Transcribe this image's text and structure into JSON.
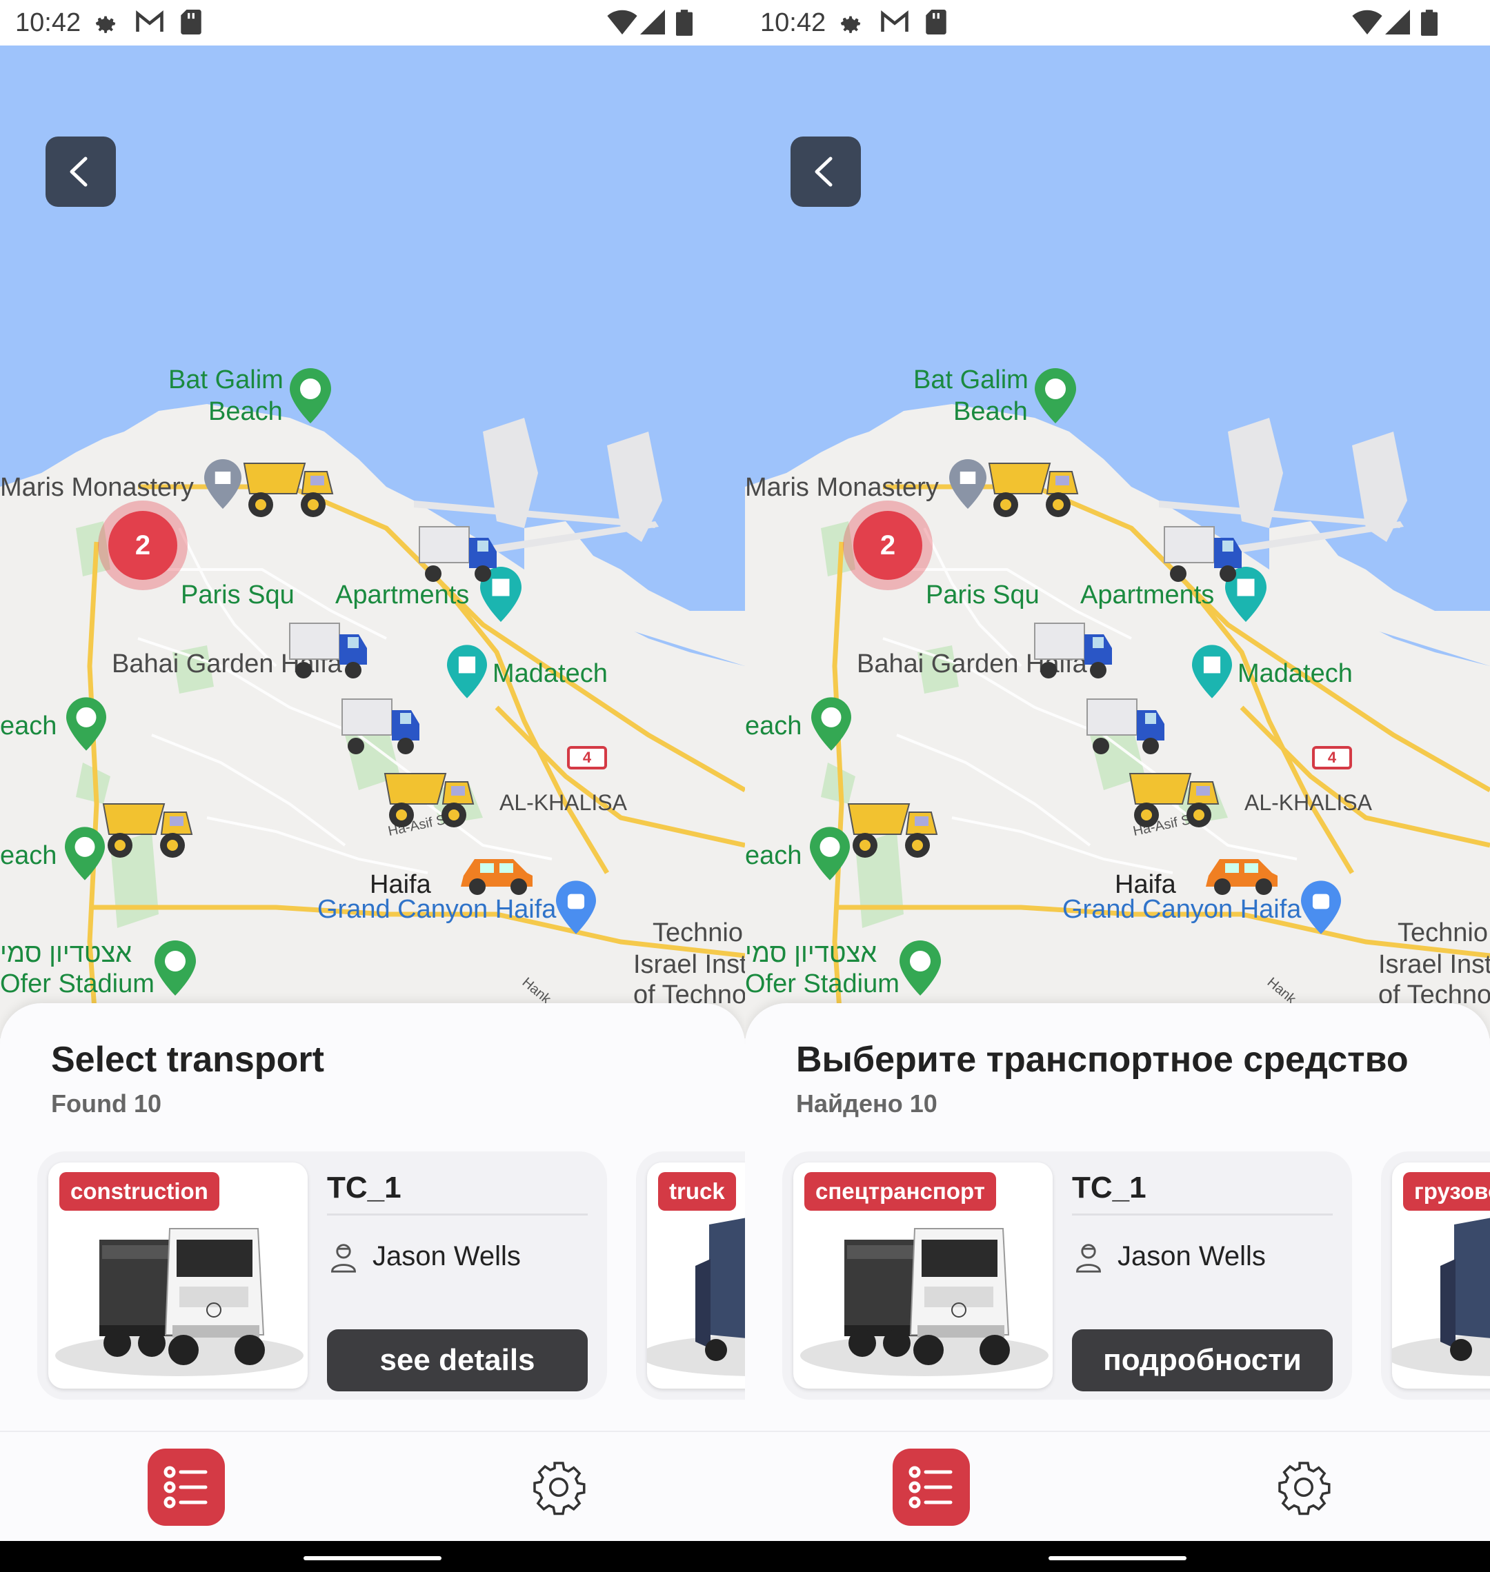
{
  "status": {
    "time": "10:42"
  },
  "map": {
    "labels": {
      "bat_galim": "Bat Galim\nBeach",
      "maris": "Maris Monastery",
      "paris": "Paris Squ",
      "apartments": "Apartments",
      "bahai": "Bahai Garden Haifa",
      "madatech": "Madatech",
      "each1": "each",
      "each2": "each",
      "al_khalisa": "AL-KHALISA",
      "ha_asif": "Ha-Asif St",
      "haifa": "Haifa",
      "grand_canyon": "Grand Canyon Haifa",
      "technion1": "Technio",
      "technion2": "Israel Inst",
      "technion3": "of Techno",
      "ofer_he": "אצטדיון סמי",
      "ofer": "Ofer Stadium",
      "hanki": "Hank",
      "route": "4"
    },
    "cluster_count": "2"
  },
  "en": {
    "title": "Select transport",
    "found": "Found 10",
    "card1": {
      "badge": "construction",
      "name": "TC_1",
      "driver": "Jason Wells",
      "button": "see details"
    },
    "card2": {
      "badge": "truck"
    }
  },
  "ru": {
    "title": "Выберите транспортное средство",
    "found": "Найдено 10",
    "card1": {
      "badge": "спецтранспорт",
      "name": "TC_1",
      "driver": "Jason Wells",
      "button": "подробности"
    },
    "card2": {
      "badge": "грузово"
    }
  },
  "colors": {
    "accent": "#d43a45",
    "back_button": "#3b4658",
    "water": "#9ec3fb",
    "details_button": "#3d3d40"
  }
}
